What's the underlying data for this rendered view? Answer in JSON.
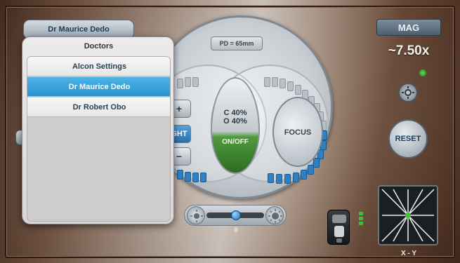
{
  "header": {
    "doctor_name": "Dr Maurice Dedo"
  },
  "console": {
    "pd_label": "PD = 65mm",
    "contrast": "C 40%",
    "other": "O 40%",
    "onoff_label": "ON/OFF",
    "focus_label": "FOCUS",
    "plus_label": "+",
    "minus_label": "−",
    "right_label": "GHT"
  },
  "slider": {
    "value": "0"
  },
  "right_panel": {
    "mag_label": "MAG",
    "mag_value": "~7.50x",
    "reset_label": "RESET",
    "xy_label": "X - Y"
  },
  "popup": {
    "title": "Doctors",
    "items": [
      {
        "label": "Alcon Settings",
        "selected": false
      },
      {
        "label": "Dr Maurice Dedo",
        "selected": true
      },
      {
        "label": "Dr Robert Obo",
        "selected": false
      }
    ]
  },
  "colors": {
    "accent_blue": "#2a93cf",
    "on_green": "#4f9a3c",
    "mag_panel": "#4d5f6f"
  },
  "icons": [
    "brightness-low-icon",
    "brightness-high-icon",
    "settings-icon",
    "camera-icon",
    "crosshair-icon"
  ]
}
